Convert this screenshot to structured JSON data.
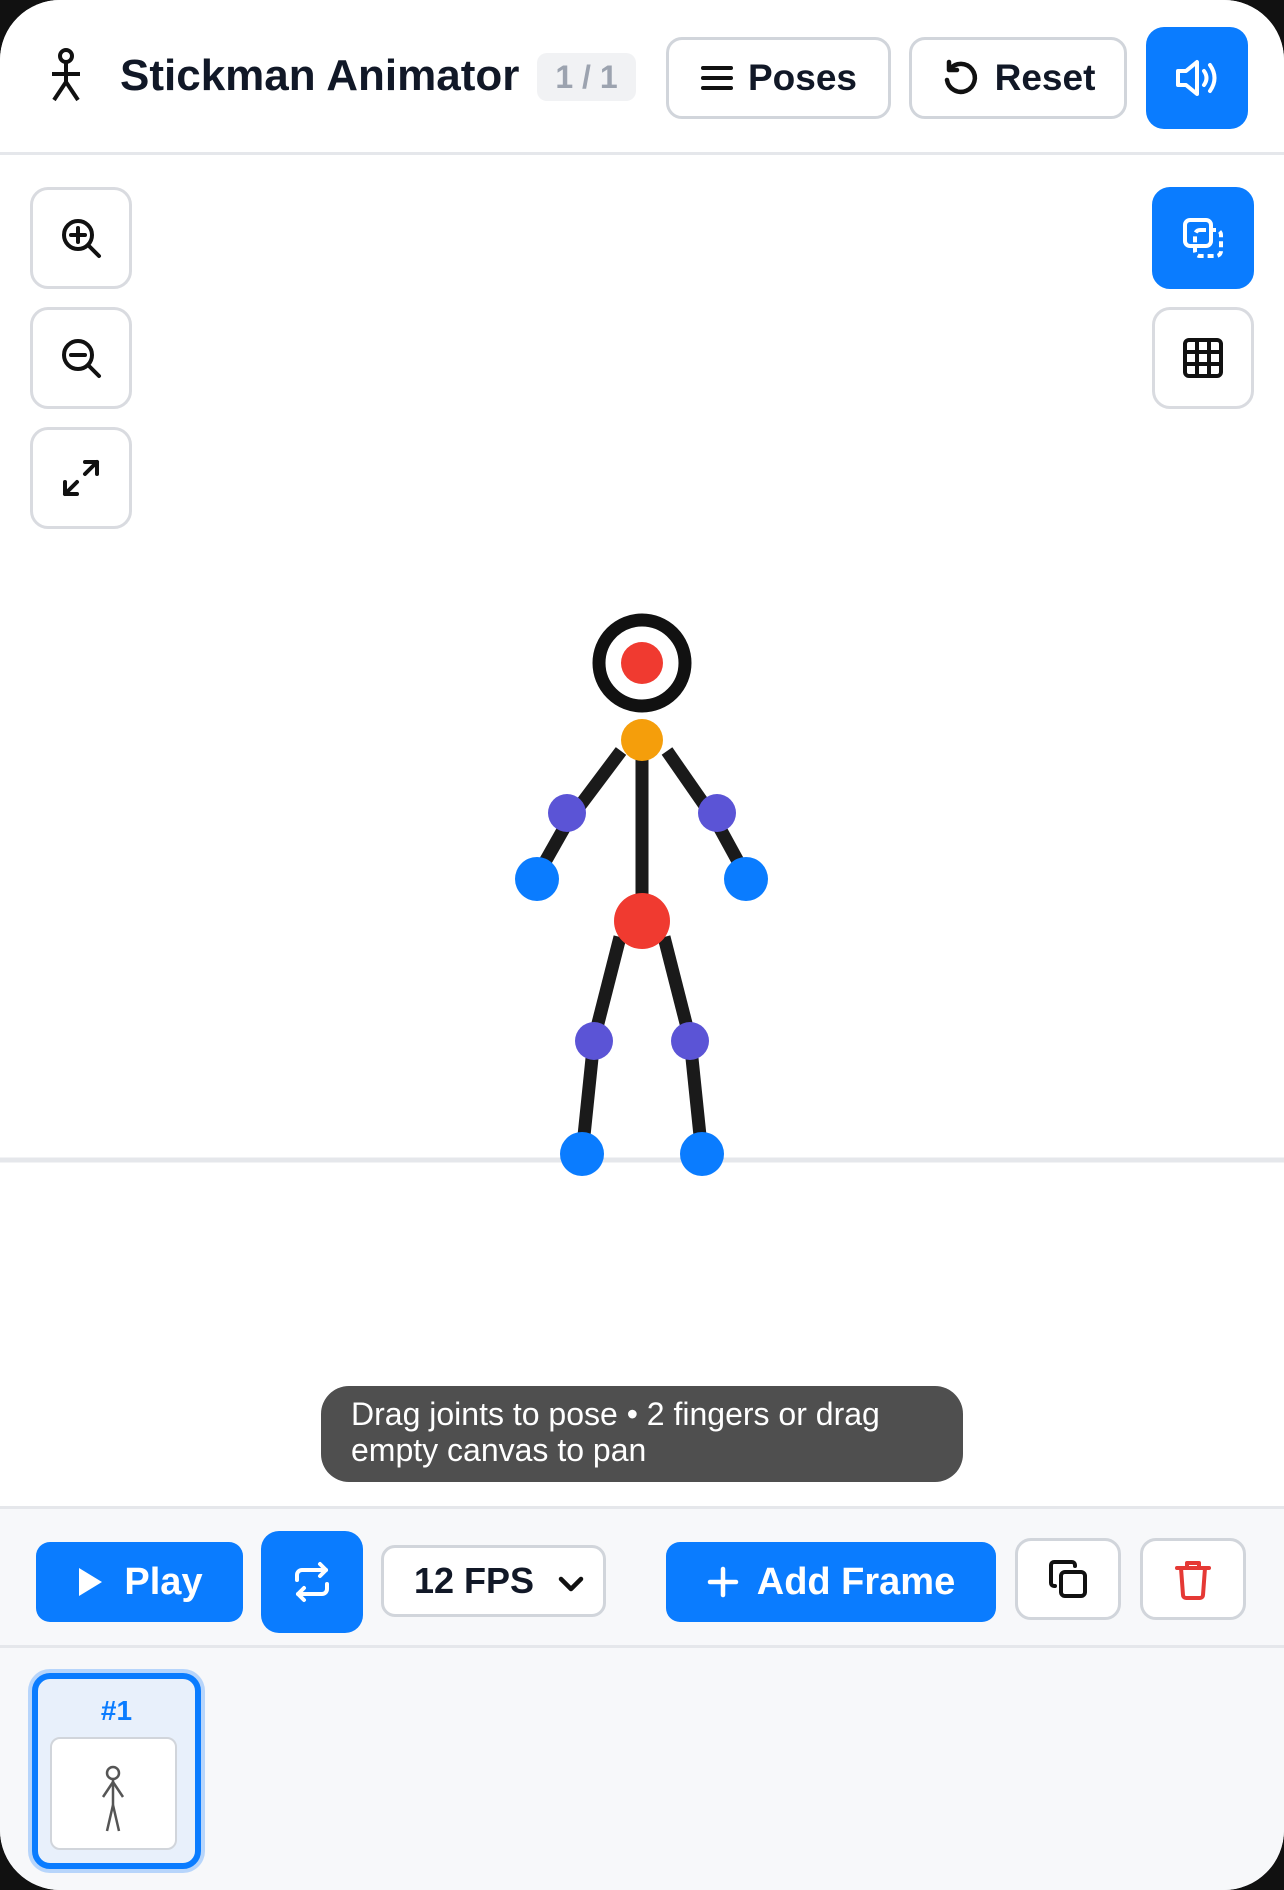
{
  "header": {
    "app_icon": "stickman-icon",
    "title": "Stickman Animator",
    "frame_counter": "1 / 1",
    "poses_label": "Poses",
    "poses_icon": "menu-icon",
    "reset_label": "Reset",
    "reset_icon": "undo-icon",
    "sound_icon": "speaker-icon",
    "sound_on": true
  },
  "canvas": {
    "left_tools": [
      "zoom-in-icon",
      "zoom-out-icon",
      "fit-view-icon"
    ],
    "right_tools": [
      {
        "icon": "onion-skin-icon",
        "active": true
      },
      {
        "icon": "grid-icon",
        "active": false
      }
    ],
    "hint": "Drag joints to pose • 2 fingers or drag empty canvas to pan"
  },
  "controls": {
    "play_label": "Play",
    "play_icon": "play-icon",
    "loop_icon": "loop-icon",
    "loop_on": true,
    "fps_value": "12 FPS",
    "add_frame_label": "Add Frame",
    "add_frame_icon": "plus-icon",
    "duplicate_icon": "duplicate-icon",
    "delete_icon": "trash-icon"
  },
  "timeline": {
    "frames": [
      {
        "label": "#1",
        "selected": true
      }
    ]
  },
  "colors": {
    "accent": "#0a7cff",
    "head_joint": "#f03a30",
    "neck_joint": "#f59e0b",
    "mid_joint": "#5b54d6",
    "end_joint": "#0a7cff",
    "hip_joint": "#f03a30",
    "delete": "#e53935"
  }
}
